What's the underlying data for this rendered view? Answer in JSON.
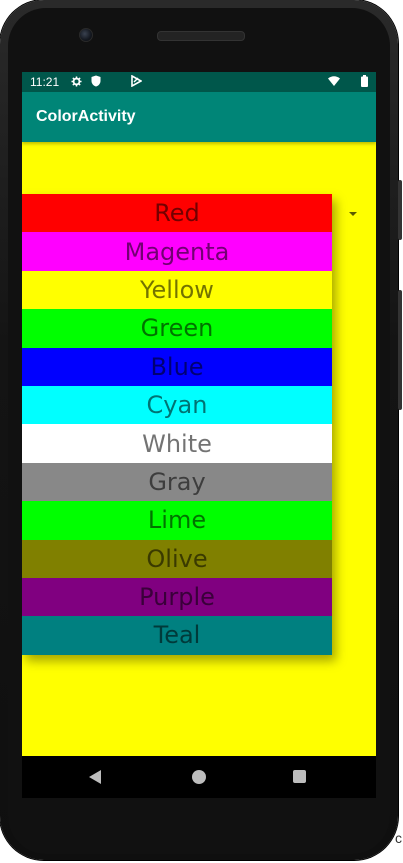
{
  "status_bar": {
    "time": "11:21",
    "icons": [
      "gear-icon",
      "shield-icon",
      "play-protect-icon",
      "wifi-icon",
      "battery-icon"
    ],
    "background": "#00574b"
  },
  "app_bar": {
    "title": "ColorActivity",
    "background": "#008577"
  },
  "screen": {
    "background": "#ffff00"
  },
  "spinner": {
    "arrow_icon": "dropdown-arrow-icon",
    "items": [
      {
        "label": "Red",
        "color": "#ff0000"
      },
      {
        "label": "Magenta",
        "color": "#ff00ff"
      },
      {
        "label": "Yellow",
        "color": "#ffff00"
      },
      {
        "label": "Green",
        "color": "#00ff00"
      },
      {
        "label": "Blue",
        "color": "#0000ff"
      },
      {
        "label": "Cyan",
        "color": "#00ffff"
      },
      {
        "label": "White",
        "color": "#ffffff"
      },
      {
        "label": "Gray",
        "color": "#888888"
      },
      {
        "label": "Lime",
        "color": "#00ff00"
      },
      {
        "label": "Olive",
        "color": "#808000"
      },
      {
        "label": "Purple",
        "color": "#800080"
      },
      {
        "label": "Teal",
        "color": "#008080"
      }
    ]
  },
  "nav_bar": {
    "back_icon": "back-triangle-icon",
    "home_icon": "home-circle-icon",
    "recents_icon": "recents-square-icon"
  },
  "background_fragment": "c"
}
